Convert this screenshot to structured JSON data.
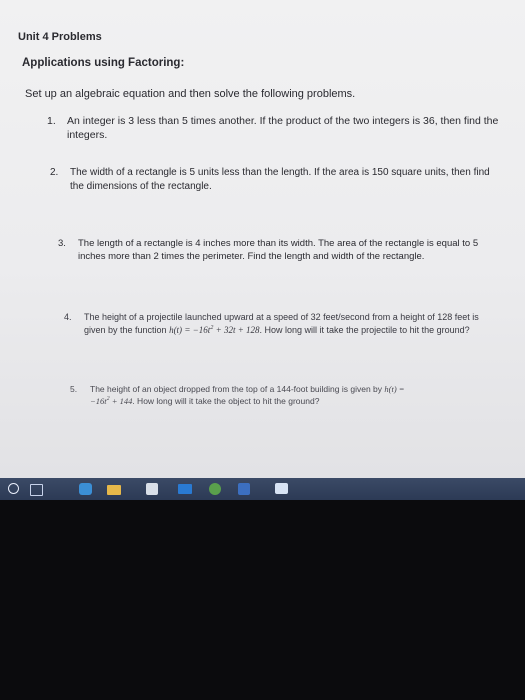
{
  "document": {
    "unit_title": "Unit 4 Problems",
    "section_title": "Applications using Factoring:",
    "instructions": "Set up an algebraic equation and then solve the following problems.",
    "problems": [
      {
        "number": "1.",
        "text": "An integer is 3 less than 5 times another. If the product of the two integers is 36, then find the integers."
      },
      {
        "number": "2.",
        "text": "The width of a rectangle is 5 units less than the length. If the area is 150 square units, then find the dimensions of the rectangle."
      },
      {
        "number": "3.",
        "text": "The length of a rectangle is 4 inches more than its width. The area of the rectangle is equal to 5 inches more than 2 times the perimeter. Find the length and width of the rectangle."
      },
      {
        "number": "4.",
        "text_before": "The height of a projectile launched upward at a speed of 32 feet/second from a height of 128 feet is given by the function ",
        "func": "h(t)",
        "eq_a": " = −16t",
        "exp": "2",
        "eq_b": " + 32t + 128",
        "text_after": ". How long will it take the projectile to hit the ground?"
      },
      {
        "number": "5.",
        "text_before": "The height of an object dropped from the top of a 144-foot building is given by ",
        "func": "h(t)",
        "eq_eq": " =",
        "eq_a": "−16t",
        "exp": "2",
        "eq_b": " + 144",
        "text_after": ". How long will it take the object to hit the ground?"
      }
    ]
  },
  "taskbar": {
    "icons": [
      "start-icon",
      "task-view-icon",
      "edge-icon",
      "file-explorer-icon",
      "store-icon",
      "mail-icon",
      "chrome-icon",
      "photos-icon",
      "app-icon"
    ]
  }
}
